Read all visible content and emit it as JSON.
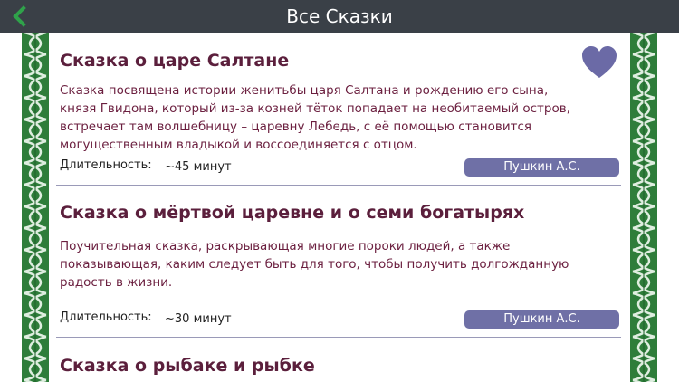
{
  "header": {
    "title": "Все Сказки"
  },
  "colors": {
    "header_bg": "#3a4047",
    "back_arrow": "#2fa24a",
    "title_text": "#5b1f3c",
    "desc_text": "#6b1f3f",
    "author_badge": "#6f70a6",
    "heart": "#6b6aa6",
    "border_green": "#2e7d3a"
  },
  "icons": {
    "back": "chevron-left-icon",
    "favorite": "heart-icon"
  },
  "tales": [
    {
      "title": "Сказка о царе Салтане",
      "description": "Сказка посвящена истории женитьбы царя Салтана и рождению его сына, князя Гвидона, который из-за козней тёток попадает на необитаемый остров, встречает там волшебницу – царевну Лебедь, с её помощью становится могущественным владыкой и воссоединяется с отцом.",
      "duration_label": "Длительность:",
      "duration": "~45 минут",
      "author": "Пушкин А.С.",
      "favorite": true
    },
    {
      "title": "Сказка о мёртвой царевне и о семи богатырях",
      "description": "Поучительная сказка, раскрывающая многие пороки людей, а также показывающая, каким следует быть для того, чтобы получить долгожданную радость в жизни.",
      "duration_label": "Длительность:",
      "duration": "~30 минут",
      "author": "Пушкин А.С.",
      "favorite": false
    },
    {
      "title": "Сказка о рыбаке и рыбке"
    }
  ]
}
